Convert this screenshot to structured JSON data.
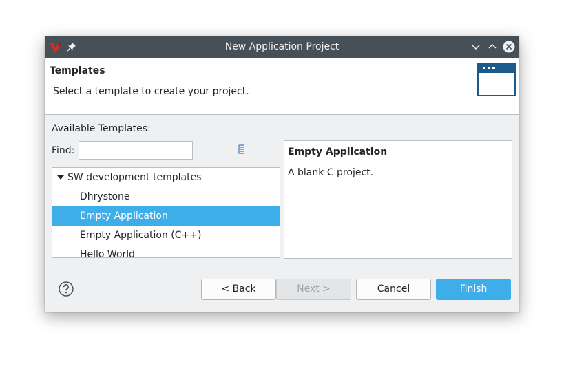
{
  "window": {
    "title": "New Application Project"
  },
  "header": {
    "title": "Templates",
    "description": "Select a template to create your project."
  },
  "templates": {
    "available_label": "Available Templates:",
    "find_label": "Find:",
    "find_value": "",
    "tree": {
      "group_label": "SW development templates",
      "expanded": true,
      "items": [
        {
          "label": "Dhrystone",
          "selected": false
        },
        {
          "label": "Empty Application",
          "selected": true
        },
        {
          "label": "Empty Application (C++)",
          "selected": false
        },
        {
          "label": "Hello World",
          "selected": false
        }
      ]
    }
  },
  "description_panel": {
    "title": "Empty Application",
    "text": "A blank C project."
  },
  "buttons": {
    "back": "< Back",
    "next": "Next >",
    "cancel": "Cancel",
    "finish": "Finish"
  },
  "colors": {
    "titlebar": "#475057",
    "selection": "#3daee9",
    "accent": "#3daee9",
    "window_bg": "#eff0f1"
  },
  "icons": {
    "app": "vitis-logo-icon",
    "pin": "pin-icon",
    "minimize": "chevron-down-icon",
    "maximize": "chevron-up-icon",
    "close": "close-icon",
    "wizard": "window-icon",
    "filter": "filter-icon",
    "help": "help-icon"
  }
}
